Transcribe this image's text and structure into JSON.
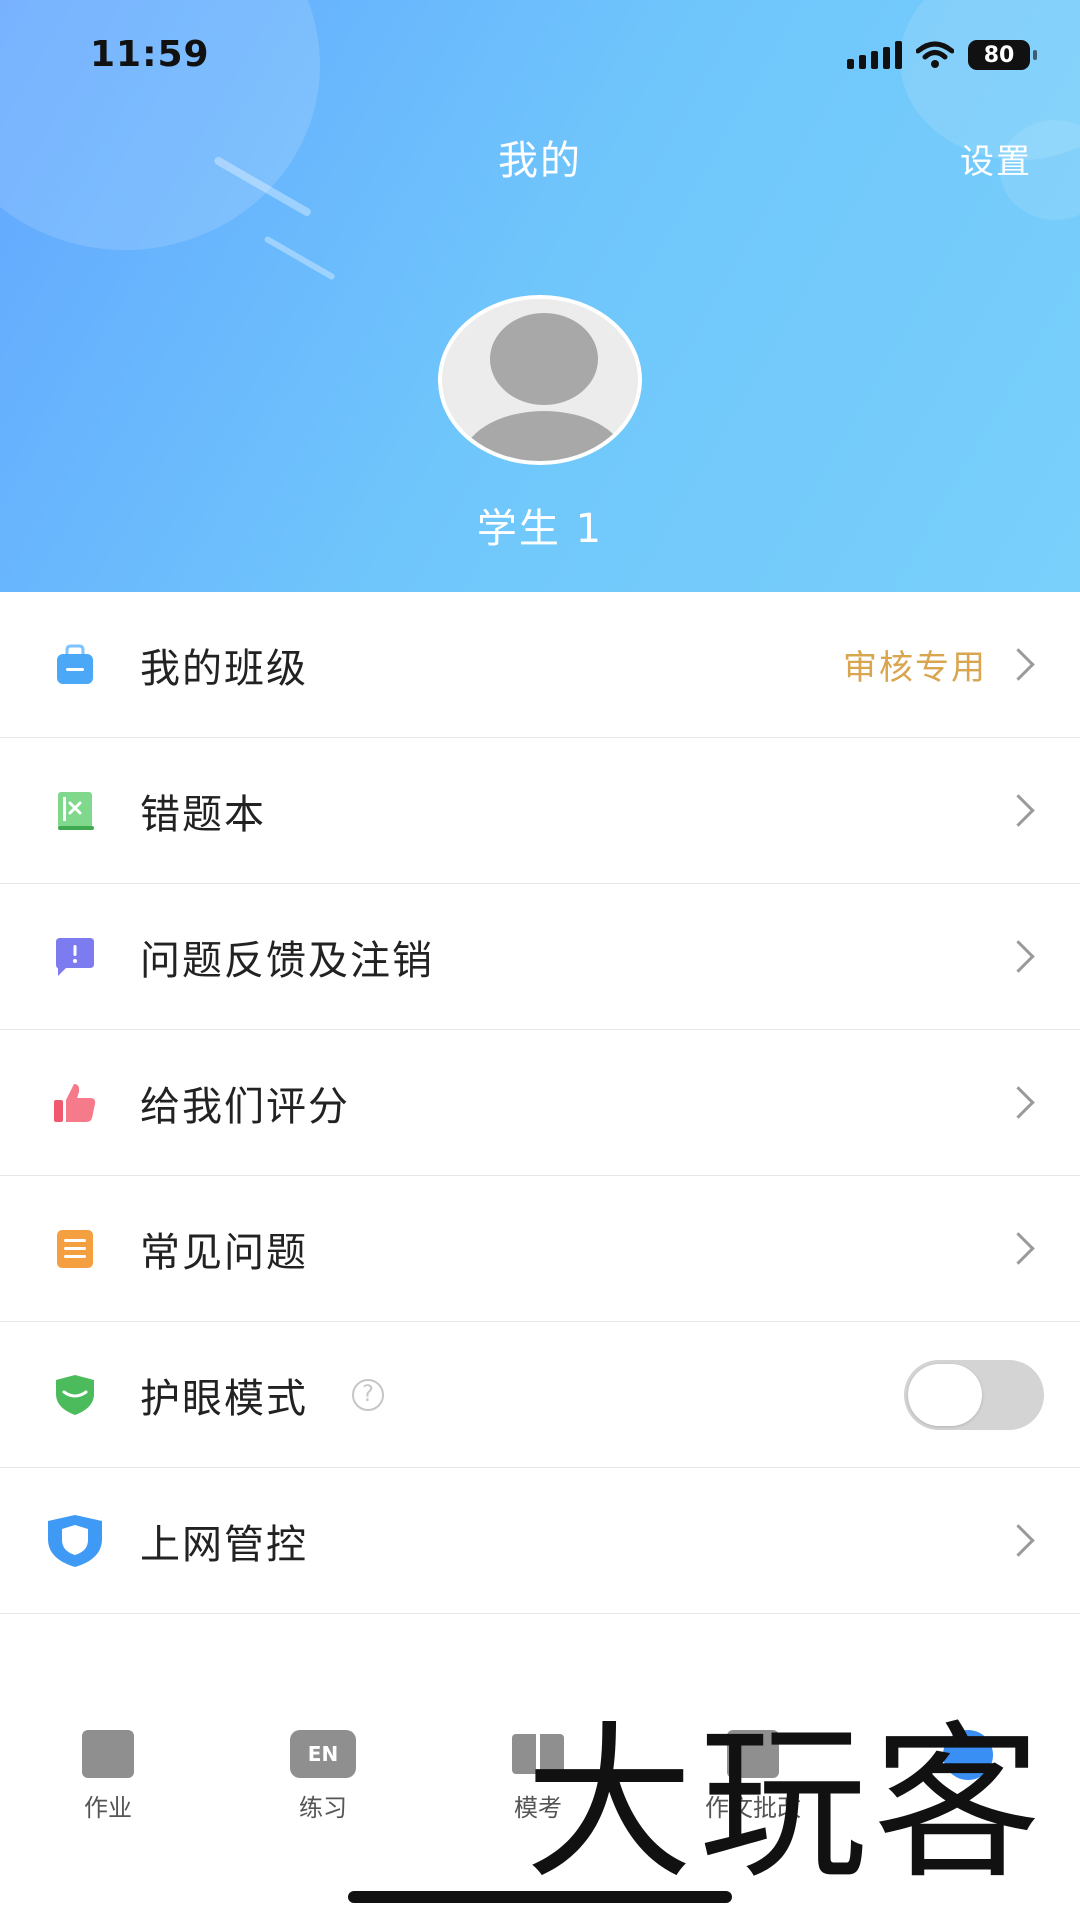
{
  "status_bar": {
    "time": "11:59",
    "battery": "80"
  },
  "header": {
    "title": "我的",
    "settings_label": "设置",
    "username": "学生 1"
  },
  "menu": [
    {
      "label": "我的班级",
      "extra": "审核专用",
      "icon": "class-bag-icon",
      "color": "#4aa8f7"
    },
    {
      "label": "错题本",
      "icon": "wrong-book-icon",
      "color": "#5ac26a"
    },
    {
      "label": "问题反馈及注销",
      "icon": "feedback-icon",
      "color": "#7c7cf0"
    },
    {
      "label": "给我们评分",
      "icon": "thumbs-up-icon",
      "color": "#f05a6e"
    },
    {
      "label": "常见问题",
      "icon": "faq-list-icon",
      "color": "#f5a040"
    },
    {
      "label": "护眼模式",
      "icon": "eye-care-icon",
      "color": "#4cbb5c",
      "toggle_on": false
    },
    {
      "label": "上网管控",
      "icon": "shield-icon",
      "color": "#3f9af5"
    }
  ],
  "tabs": [
    {
      "label": "作业",
      "icon": "homework-icon"
    },
    {
      "label": "练习",
      "icon": "en-practice-icon",
      "icon_text": "EN"
    },
    {
      "label": "模考",
      "icon": "exam-book-icon"
    },
    {
      "label": "作文批改",
      "icon": "essay-icon"
    },
    {
      "label": "",
      "icon": "profile-icon"
    }
  ],
  "watermark": "大玩客"
}
